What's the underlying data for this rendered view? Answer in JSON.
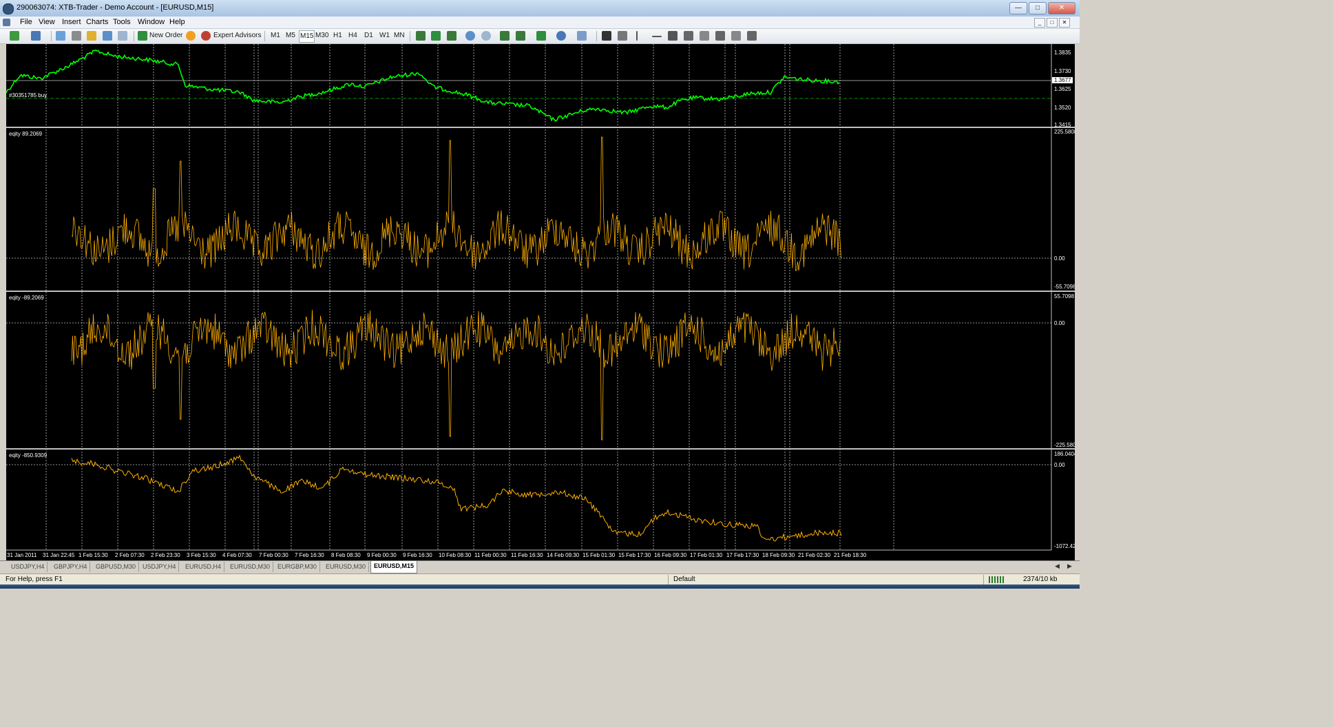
{
  "window": {
    "title": "290063074: XTB-Trader - Demo Account - [EURUSD,M15]",
    "min_icon": "minimize-icon",
    "max_icon": "maximize-icon",
    "close_icon": "close-icon"
  },
  "menu": [
    "File",
    "View",
    "Insert",
    "Charts",
    "Tools",
    "Window",
    "Help"
  ],
  "toolbar": {
    "new_order": "New Order",
    "expert_advisors": "Expert Advisors",
    "timeframes": [
      "M1",
      "M5",
      "M15",
      "M30",
      "H1",
      "H4",
      "D1",
      "W1",
      "MN"
    ],
    "active_timeframe": "M15"
  },
  "chart": {
    "symbol": "EURUSD,M15",
    "background": "#000000",
    "price_line_color": "#00ff00",
    "indicator_color": "#ffb000",
    "price_panel": {
      "axis_ticks": [
        "1.3835",
        "1.3730",
        "1.3625",
        "1.3520",
        "1.3415"
      ],
      "current_price": "1.3677",
      "order_label": "#30351785 buy"
    },
    "panels": [
      {
        "label": "eqity 89.2069",
        "axis_top": "225.5808",
        "axis_zero": "0.00",
        "axis_bottom": "-55.7098"
      },
      {
        "label": "eqity -89.2069",
        "axis_top": "55.7098",
        "axis_zero": "0.00",
        "axis_bottom": "-225.580"
      },
      {
        "label": "eqity -850.9309",
        "axis_top": "186.0404",
        "axis_zero": "0.00",
        "axis_bottom": "-1072.42"
      }
    ],
    "dates": [
      "31 Jan 2011",
      "31 Jan 22:45",
      "1 Feb 15:30",
      "2 Feb 07:30",
      "2 Feb 23:30",
      "3 Feb 15:30",
      "4 Feb 07:30",
      "7 Feb 00:30",
      "7 Feb 16:30",
      "8 Feb 08:30",
      "9 Feb 00:30",
      "9 Feb 16:30",
      "10 Feb 08:30",
      "11 Feb 00:30",
      "11 Feb 16:30",
      "14 Feb 09:30",
      "15 Feb 01:30",
      "15 Feb 17:30",
      "16 Feb 09:30",
      "17 Feb 01:30",
      "17 Feb 17:30",
      "18 Feb 09:30",
      "21 Feb 02:30",
      "21 Feb 18:30"
    ]
  },
  "tabs": [
    "USDJPY,H4",
    "GBPJPY,H4",
    "GBPUSD,M30",
    "USDJPY,H4",
    "EURUSD,H4",
    "EURUSD,M30",
    "EURGBP,M30",
    "EURUSD,M30",
    "EURUSD,M15"
  ],
  "active_tab": "EURUSD,M15",
  "status": {
    "help": "For Help, press F1",
    "profile": "Default",
    "traffic": "2374/10 kb"
  }
}
